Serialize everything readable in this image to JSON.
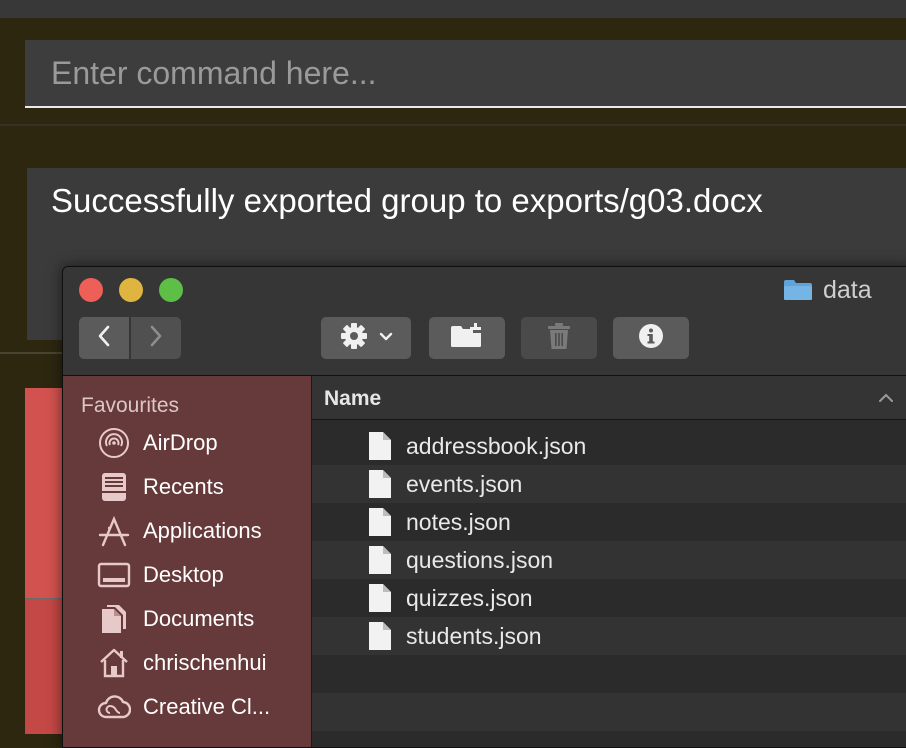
{
  "command": {
    "placeholder": "Enter command here..."
  },
  "result": {
    "message": "Successfully exported group to exports/g03.docx"
  },
  "finder": {
    "title": "data",
    "toolbar": {
      "back_icon": "chevron-left-icon",
      "forward_icon": "chevron-right-icon",
      "action_icon": "gear-icon",
      "new_folder_icon": "new-folder-icon",
      "trash_icon": "trash-icon",
      "info_icon": "info-icon"
    },
    "sidebar": {
      "section": "Favourites",
      "items": [
        {
          "label": "AirDrop",
          "icon": "airdrop-icon"
        },
        {
          "label": "Recents",
          "icon": "recents-icon"
        },
        {
          "label": "Applications",
          "icon": "applications-icon"
        },
        {
          "label": "Desktop",
          "icon": "desktop-icon"
        },
        {
          "label": "Documents",
          "icon": "documents-icon"
        },
        {
          "label": "chrischenhui",
          "icon": "home-icon"
        },
        {
          "label": "Creative Cl...",
          "icon": "creative-cloud-icon"
        }
      ]
    },
    "list": {
      "column": "Name",
      "files": [
        "addressbook.json",
        "events.json",
        "notes.json",
        "questions.json",
        "quizzes.json",
        "students.json"
      ]
    }
  },
  "colors": {
    "background": "#2d2710",
    "sidebar": "#66393a",
    "close": "#ed5f57",
    "minimize": "#e0b53f",
    "zoom": "#5dbf46",
    "folder": "#5ea3d9"
  }
}
